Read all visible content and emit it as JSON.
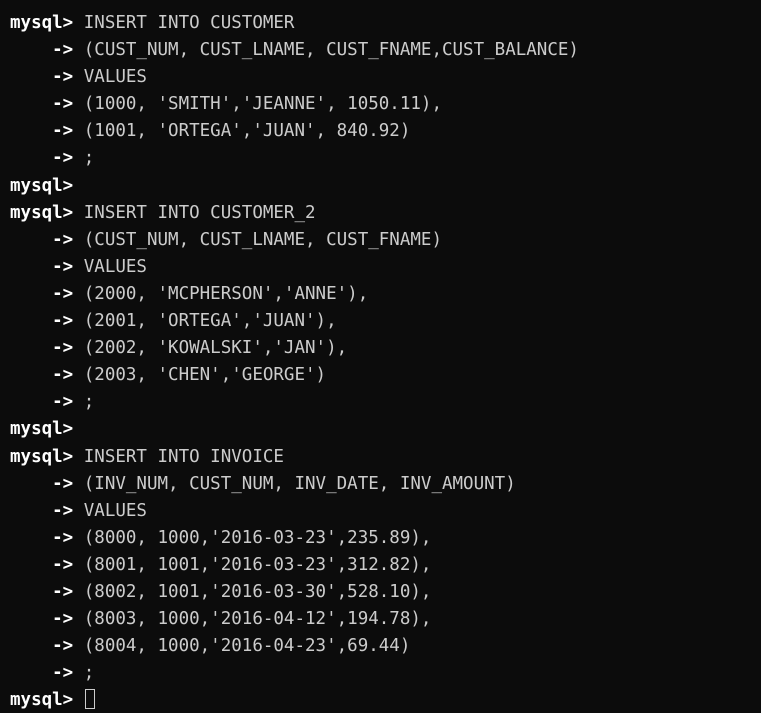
{
  "terminal": {
    "prompt": "mysql>",
    "continuation": "    ->",
    "lines": [
      {
        "kind": "prompt",
        "text": "INSERT INTO CUSTOMER"
      },
      {
        "kind": "cont",
        "text": "(CUST_NUM, CUST_LNAME, CUST_FNAME,CUST_BALANCE)"
      },
      {
        "kind": "cont",
        "text": "VALUES"
      },
      {
        "kind": "cont",
        "text": "(1000, 'SMITH','JEANNE', 1050.11),"
      },
      {
        "kind": "cont",
        "text": "(1001, 'ORTEGA','JUAN', 840.92)"
      },
      {
        "kind": "cont",
        "text": ";"
      },
      {
        "kind": "prompt",
        "text": ""
      },
      {
        "kind": "prompt",
        "text": "INSERT INTO CUSTOMER_2"
      },
      {
        "kind": "cont",
        "text": "(CUST_NUM, CUST_LNAME, CUST_FNAME)"
      },
      {
        "kind": "cont",
        "text": "VALUES"
      },
      {
        "kind": "cont",
        "text": "(2000, 'MCPHERSON','ANNE'),"
      },
      {
        "kind": "cont",
        "text": "(2001, 'ORTEGA','JUAN'),"
      },
      {
        "kind": "cont",
        "text": "(2002, 'KOWALSKI','JAN'),"
      },
      {
        "kind": "cont",
        "text": "(2003, 'CHEN','GEORGE')"
      },
      {
        "kind": "cont",
        "text": ";"
      },
      {
        "kind": "prompt",
        "text": ""
      },
      {
        "kind": "prompt",
        "text": "INSERT INTO INVOICE"
      },
      {
        "kind": "cont",
        "text": "(INV_NUM, CUST_NUM, INV_DATE, INV_AMOUNT)"
      },
      {
        "kind": "cont",
        "text": "VALUES"
      },
      {
        "kind": "cont",
        "text": "(8000, 1000,'2016-03-23',235.89),"
      },
      {
        "kind": "cont",
        "text": "(8001, 1001,'2016-03-23',312.82),"
      },
      {
        "kind": "cont",
        "text": "(8002, 1001,'2016-03-30',528.10),"
      },
      {
        "kind": "cont",
        "text": "(8003, 1000,'2016-04-12',194.78),"
      },
      {
        "kind": "cont",
        "text": "(8004, 1000,'2016-04-23',69.44)"
      },
      {
        "kind": "cont",
        "text": ";"
      },
      {
        "kind": "active",
        "text": ""
      }
    ]
  },
  "colors": {
    "background": "#0c0c0c",
    "text": "#cccccc",
    "prompt": "#ffffff"
  }
}
